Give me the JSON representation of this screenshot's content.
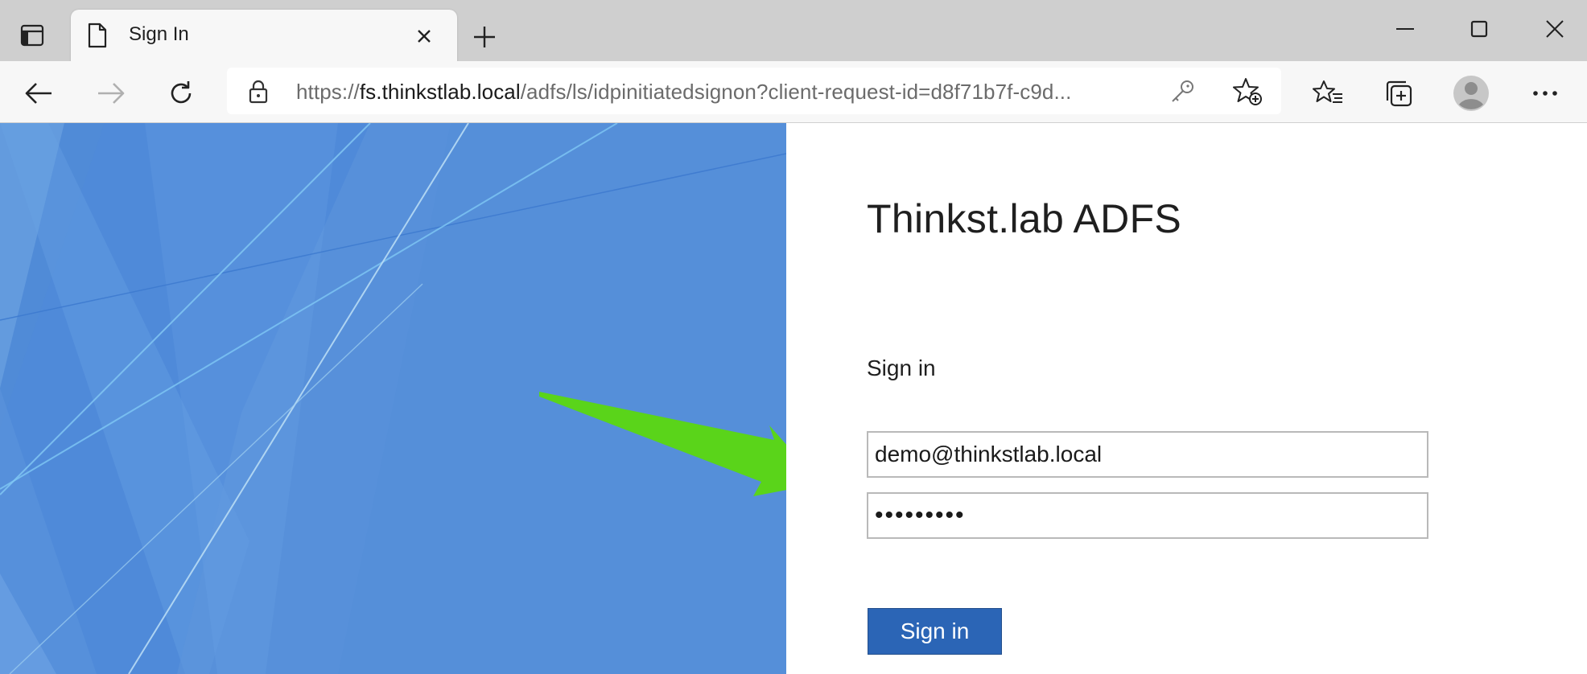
{
  "browser": {
    "tab": {
      "title": "Sign In"
    },
    "address": {
      "scheme": "https://",
      "host": "fs.thinkstlab.local",
      "path": "/adfs/ls/idpinitiatedsignon?client-request-id=d8f71b7f-c9d..."
    },
    "icons": {
      "tab_actions": "tab-actions-icon",
      "document": "document-icon",
      "close": "close-icon",
      "new_tab": "plus-icon",
      "minimize": "minimize-icon",
      "maximize": "maximize-icon",
      "window_close": "window-close-icon",
      "back": "back-arrow-icon",
      "forward": "forward-arrow-icon",
      "refresh": "refresh-icon",
      "lock": "lock-icon",
      "key": "key-icon",
      "add_favorite": "star-add-icon",
      "favorites": "favorites-icon",
      "collections": "collections-icon",
      "profile": "profile-icon",
      "more": "more-icon"
    }
  },
  "login": {
    "brand": "Thinkst.lab ADFS",
    "heading": "Sign in",
    "username_value": "demo@thinkstlab.local",
    "password_value": "•••••••••",
    "submit_label": "Sign in"
  },
  "colors": {
    "panel_blue": "#558fd9",
    "button_blue": "#2b65b6",
    "annotation_arrow": "#5ad41a"
  }
}
